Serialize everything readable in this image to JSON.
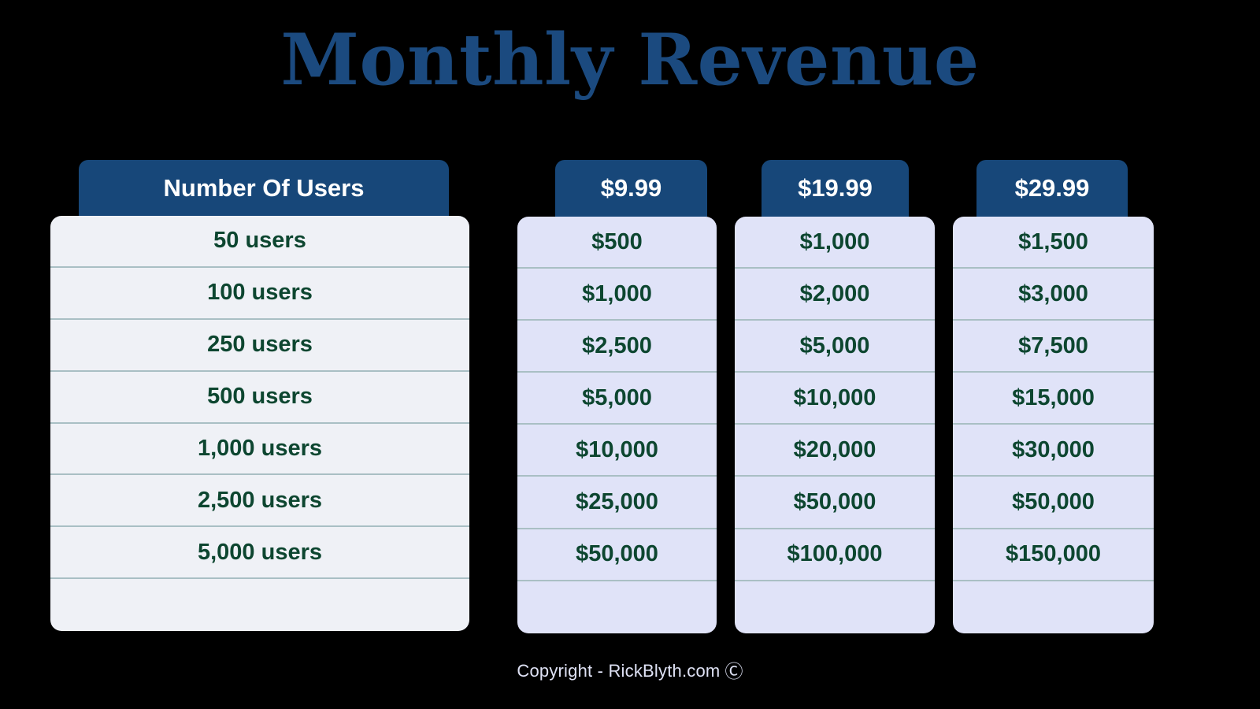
{
  "title": "Monthly Revenue",
  "footer": {
    "text": "Copyright - RickBlyth.com",
    "mark": "Ⓒ"
  },
  "colors": {
    "background": "#000000",
    "title_blue": "#1b4a7f",
    "header_blue": "#174779",
    "panel_users": "#eff1f6",
    "panel_price": "#e0e3f8",
    "value_green": "#0d4630",
    "divider": "#a9bfc4",
    "footer_text": "#dfe2f5"
  },
  "chart_data": {
    "type": "table",
    "title": "Monthly Revenue",
    "xlabel": "",
    "ylabel": "",
    "columns": [
      "Number Of Users",
      "$9.99",
      "$19.99",
      "$29.99"
    ],
    "categories": [
      "50 users",
      "100 users",
      "250 users",
      "500 users",
      "1,000 users",
      "2,500 users",
      "5,000 users"
    ],
    "series": [
      {
        "name": "$9.99",
        "values": [
          "$500",
          "$1,000",
          "$2,500",
          "$5,000",
          "$10,000",
          "$25,000",
          "$50,000"
        ]
      },
      {
        "name": "$19.99",
        "values": [
          "$1,000",
          "$2,000",
          "$5,000",
          "$10,000",
          "$20,000",
          "$50,000",
          "$100,000"
        ]
      },
      {
        "name": "$29.99",
        "values": [
          "$1,500",
          "$3,000",
          "$7,500",
          "$15,000",
          "$30,000",
          "$50,000",
          "$150,000"
        ]
      }
    ]
  },
  "table": {
    "users_column": {
      "header": "Number Of Users",
      "rows": [
        "50 users",
        "100 users",
        "250 users",
        "500 users",
        "1,000 users",
        "2,500 users",
        "5,000 users",
        ""
      ]
    },
    "price_columns": [
      {
        "header": "$9.99",
        "rows": [
          "$500",
          "$1,000",
          "$2,500",
          "$5,000",
          "$10,000",
          "$25,000",
          "$50,000",
          ""
        ]
      },
      {
        "header": "$19.99",
        "rows": [
          "$1,000",
          "$2,000",
          "$5,000",
          "$10,000",
          "$20,000",
          "$50,000",
          "$100,000",
          ""
        ]
      },
      {
        "header": "$29.99",
        "rows": [
          "$1,500",
          "$3,000",
          "$7,500",
          "$15,000",
          "$30,000",
          "$50,000",
          "$150,000",
          ""
        ]
      }
    ]
  }
}
